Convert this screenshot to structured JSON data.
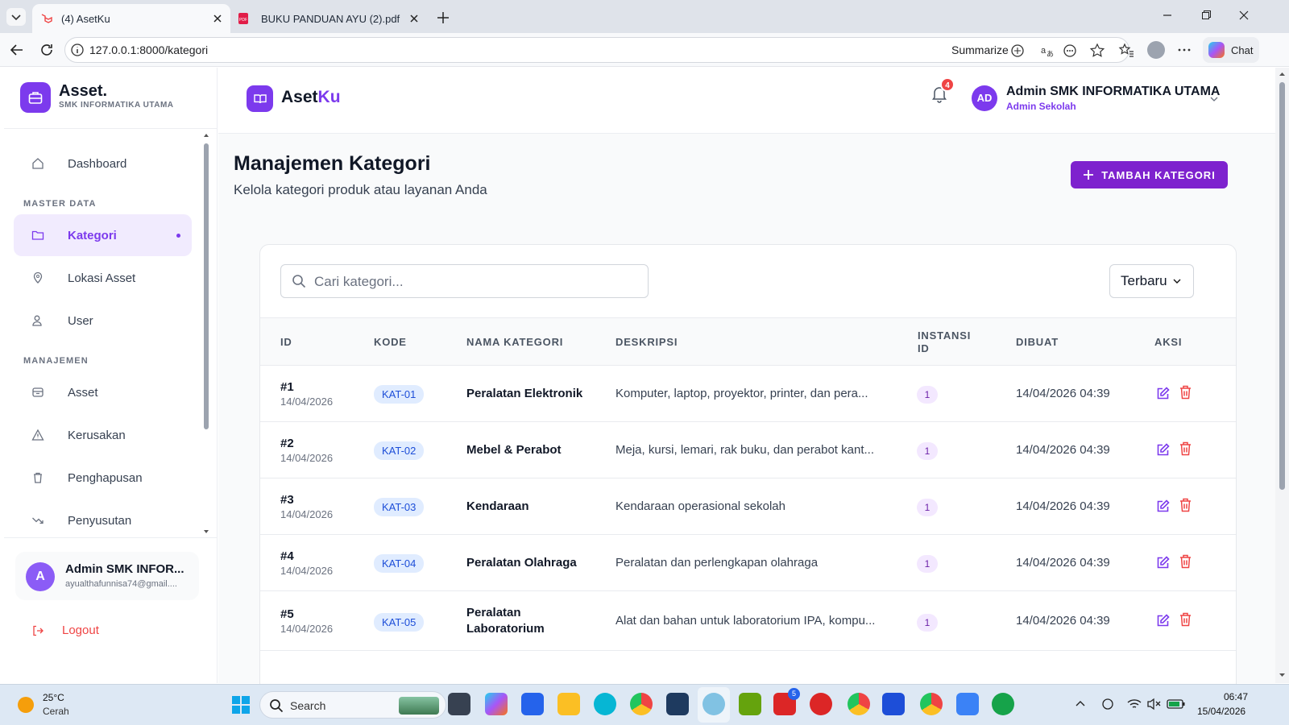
{
  "browser": {
    "tabs": [
      {
        "title": "(4) AsetKu",
        "active": true
      },
      {
        "title": "BUKU PANDUAN AYU (2).pdf",
        "active": false
      }
    ],
    "url": "127.0.0.1:8000/kategori",
    "summarize_label": "Summarize",
    "chat_label": "Chat"
  },
  "sidebar": {
    "brand_title": "Asset.",
    "brand_subtitle": "SMK INFORMATIKA UTAMA",
    "dashboard": "Dashboard",
    "section_master": "MASTER DATA",
    "kategori": "Kategori",
    "lokasi": "Lokasi Asset",
    "user": "User",
    "section_manajemen": "MANAJEMEN",
    "asset": "Asset",
    "kerusakan": "Kerusakan",
    "penghapusan": "Penghapusan",
    "penyusutan": "Penyusutan",
    "profile_initial": "A",
    "profile_name": "Admin SMK INFOR...",
    "profile_email": "ayualthafunnisa74@gmail....",
    "logout": "Logout"
  },
  "header": {
    "logo_prefix": "Aset",
    "logo_suffix": "Ku",
    "notif_count": "4",
    "user_initials": "AD",
    "user_name": "Admin SMK INFORMATIKA UTAMA",
    "user_role": "Admin Sekolah"
  },
  "page": {
    "title": "Manajemen Kategori",
    "subtitle": "Kelola kategori produk atau layanan Anda",
    "add_button": "TAMBAH KATEGORI",
    "search_placeholder": "Cari kategori...",
    "sort_label": "Terbaru"
  },
  "table": {
    "headers": {
      "id": "ID",
      "kode": "KODE",
      "nama": "NAMA KATEGORI",
      "deskripsi": "DESKRIPSI",
      "instansi_1": "INSTANSI",
      "instansi_2": "ID",
      "dibuat": "DIBUAT",
      "aksi": "AKSI"
    },
    "rows": [
      {
        "id": "#1",
        "date": "14/04/2026",
        "kode": "KAT-01",
        "nama": "Peralatan Elektronik",
        "nama2": "",
        "deskripsi": "Komputer, laptop, proyektor, printer, dan pera...",
        "instansi": "1",
        "dibuat": "14/04/2026 04:39"
      },
      {
        "id": "#2",
        "date": "14/04/2026",
        "kode": "KAT-02",
        "nama": "Mebel & Perabot",
        "nama2": "",
        "deskripsi": "Meja, kursi, lemari, rak buku, dan perabot kant...",
        "instansi": "1",
        "dibuat": "14/04/2026 04:39"
      },
      {
        "id": "#3",
        "date": "14/04/2026",
        "kode": "KAT-03",
        "nama": "Kendaraan",
        "nama2": "",
        "deskripsi": "Kendaraan operasional sekolah",
        "instansi": "1",
        "dibuat": "14/04/2026 04:39"
      },
      {
        "id": "#4",
        "date": "14/04/2026",
        "kode": "KAT-04",
        "nama": "Peralatan Olahraga",
        "nama2": "",
        "deskripsi": "Peralatan dan perlengkapan olahraga",
        "instansi": "1",
        "dibuat": "14/04/2026 04:39"
      },
      {
        "id": "#5",
        "date": "14/04/2026",
        "kode": "KAT-05",
        "nama": "Peralatan",
        "nama2": "Laboratorium",
        "deskripsi": "Alat dan bahan untuk laboratorium IPA, kompu...",
        "instansi": "1",
        "dibuat": "14/04/2026 04:39"
      }
    ]
  },
  "taskbar": {
    "temp": "25°C",
    "weather": "Cerah",
    "search": "Search",
    "badge_l": "5",
    "time": "06:47",
    "date": "15/04/2026"
  }
}
